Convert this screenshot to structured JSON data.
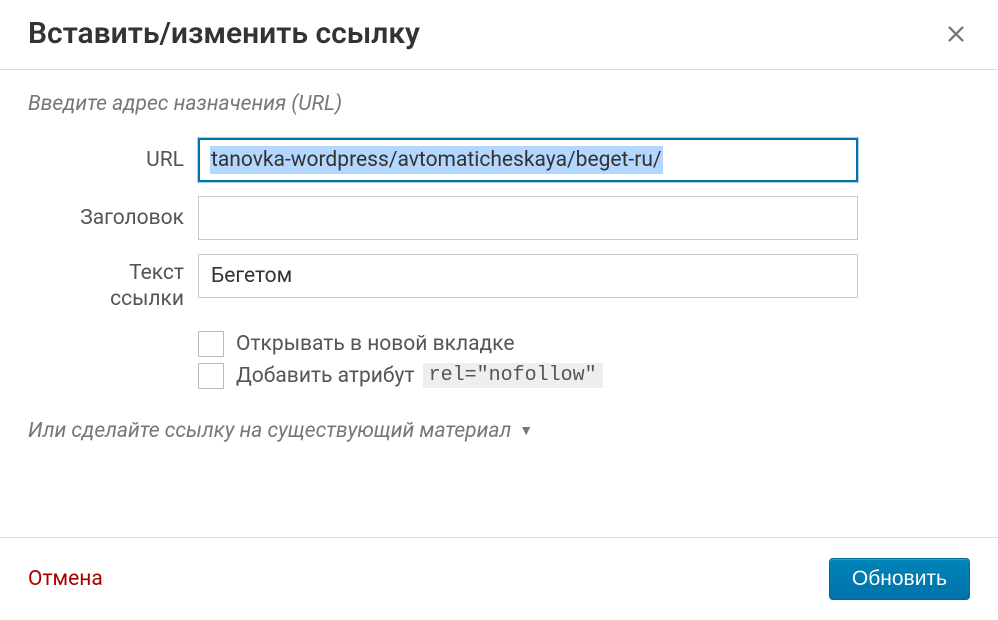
{
  "dialog": {
    "title": "Вставить/изменить ссылку",
    "section_label": "Введите адрес назначения (URL)",
    "fields": {
      "url": {
        "label": "URL",
        "value": "tanovka-wordpress/avtomaticheskaya/beget-ru/"
      },
      "title": {
        "label": "Заголовок",
        "value": ""
      },
      "link_text": {
        "label_line1": "Текст",
        "label_line2": "ссылки",
        "value": "Бегетом"
      }
    },
    "checkboxes": {
      "new_tab": {
        "label": "Открывать в новой вкладке",
        "checked": false
      },
      "nofollow": {
        "label": "Добавить атрибут",
        "code": "rel=\"nofollow\"",
        "checked": false
      }
    },
    "existing_content_label": "Или сделайте ссылку на существующий материал",
    "footer": {
      "cancel": "Отмена",
      "submit": "Обновить"
    }
  }
}
